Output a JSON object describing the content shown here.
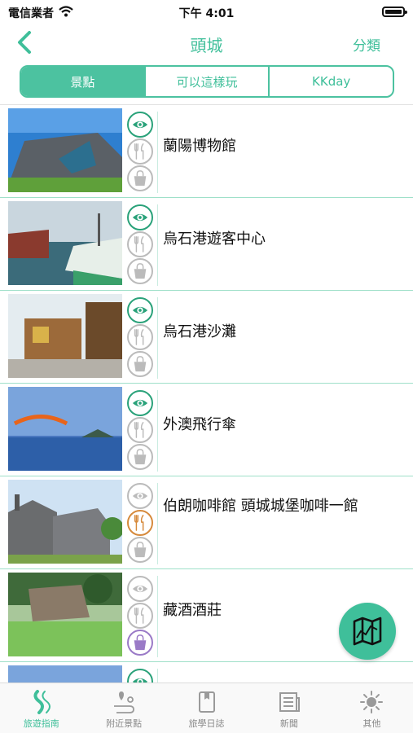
{
  "status": {
    "carrier": "電信業者",
    "time": "下午 4:01"
  },
  "nav": {
    "title": "頭城",
    "category_label": "分類"
  },
  "segments": [
    {
      "label": "景點",
      "active": true
    },
    {
      "label": "可以這樣玩",
      "active": false
    },
    {
      "label": "KKday",
      "active": false
    }
  ],
  "attractions": [
    {
      "name": "蘭陽博物館",
      "sight": true,
      "food": false,
      "shop": false
    },
    {
      "name": "烏石港遊客中心",
      "sight": true,
      "food": false,
      "shop": false
    },
    {
      "name": "烏石港沙灘",
      "sight": true,
      "food": false,
      "shop": false
    },
    {
      "name": "外澳飛行傘",
      "sight": true,
      "food": false,
      "shop": false
    },
    {
      "name": "伯朗咖啡館 頭城城堡咖啡一館",
      "sight": false,
      "food": true,
      "shop": false
    },
    {
      "name": "藏酒酒莊",
      "sight": false,
      "food": false,
      "shop": true
    },
    {
      "name": "",
      "sight": true,
      "food": false,
      "shop": false
    }
  ],
  "tabs": [
    {
      "label": "旅遊指南",
      "icon": "road-icon",
      "active": true
    },
    {
      "label": "附近景點",
      "icon": "nearby-pin-icon",
      "active": false
    },
    {
      "label": "旅學日誌",
      "icon": "journal-icon",
      "active": false
    },
    {
      "label": "新聞",
      "icon": "newspaper-icon",
      "active": false
    },
    {
      "label": "其他",
      "icon": "sun-icon",
      "active": false
    }
  ],
  "colors": {
    "accent": "#3fbf9a",
    "sight_on": "#2aa27a",
    "food_on": "#d68a3c",
    "shop_on": "#9a7ac7",
    "off": "#bbbbbb"
  }
}
